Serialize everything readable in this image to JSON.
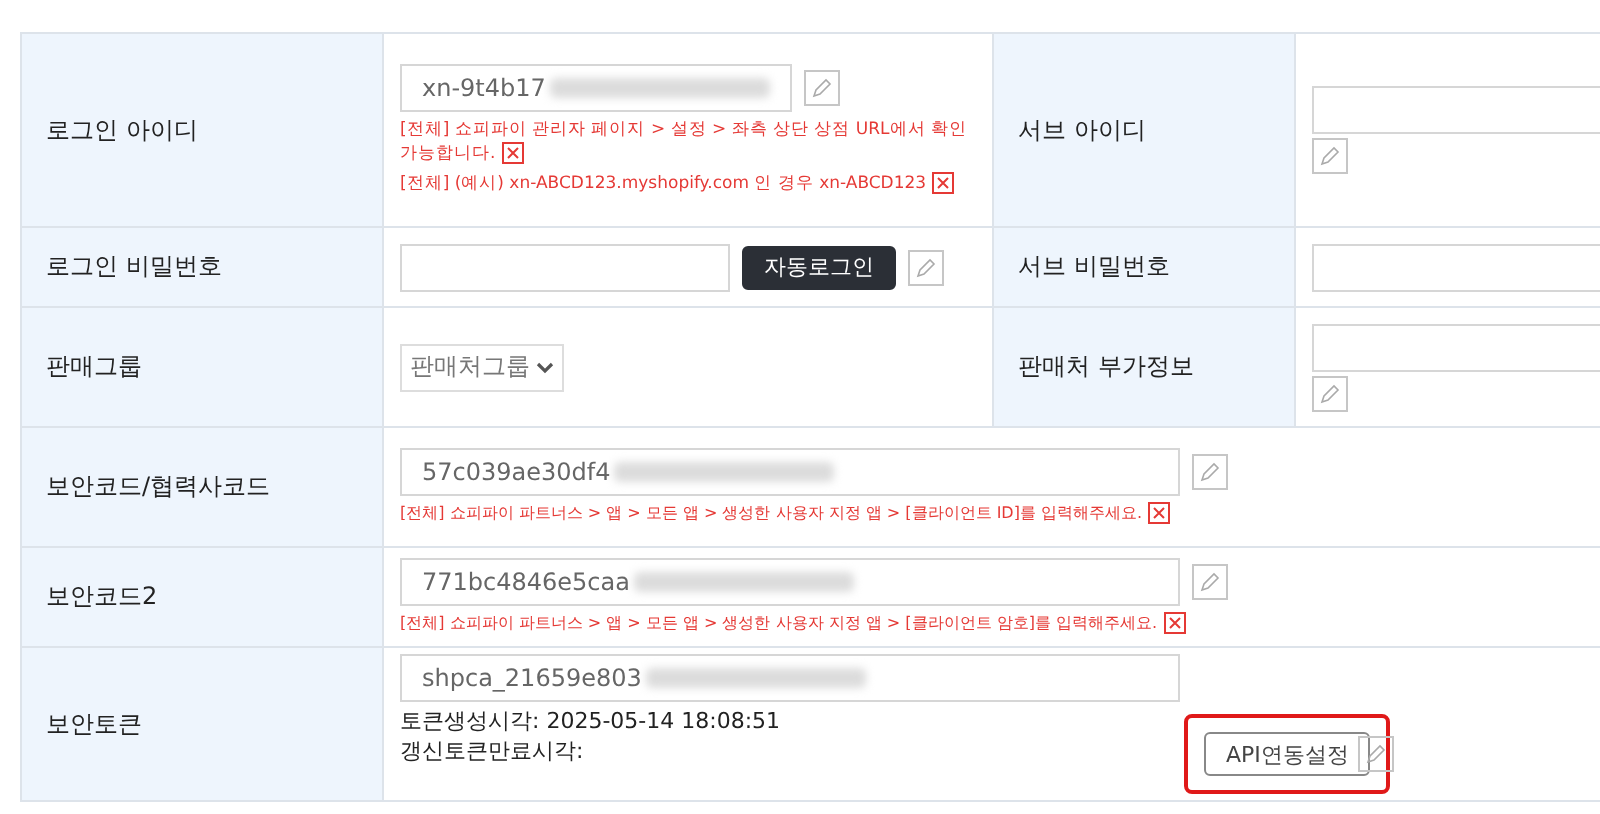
{
  "rows": [
    {
      "label": "로그인 아이디",
      "field": {
        "value": "xn-9t4b17",
        "blurred": true
      },
      "edit": true,
      "hints": [
        "[전체] 쇼피파이 관리자 페이지 > 설정 > 좌측 상단 상점 URL에서 확인 가능합니다.",
        "[전체] (예시) xn-ABCD123.myshopify.com 인 경우 xn-ABCD123"
      ],
      "side": {
        "label": "서브 아이디",
        "edit_below": true
      }
    },
    {
      "label": "로그인 비밀번호",
      "field": {},
      "button": {
        "label": "자동로그인",
        "kind": "dark"
      },
      "edit": true,
      "side": {
        "label": "서브 비밀번호"
      }
    },
    {
      "label": "판매그룹",
      "select": {
        "value": "판매처그룹"
      },
      "side": {
        "label": "판매처 부가정보",
        "edit_below": true
      }
    },
    {
      "label": "보안코드/협력사코드",
      "field": {
        "value": "57c039ae30df4",
        "blurred": true
      },
      "edit": true,
      "hints": [
        "[전체] 쇼피파이 파트너스 > 앱 > 모든 앱 > 생성한 사용자 지정 앱 > [클라이언트 ID]를 입력해주세요."
      ]
    },
    {
      "label": "보안코드2",
      "field": {
        "value": "771bc4846e5caa",
        "blurred": true
      },
      "edit": true,
      "hints": [
        "[전체] 쇼피파이 파트너스 > 앱 > 모든 앱 > 생성한 사용자 지정 앱 > [클라이언트 암호]를 입력해주세요."
      ]
    },
    {
      "label": "보안토큰",
      "field": {
        "value": "shpca_21659e803",
        "blurred": true
      },
      "info": [
        "토큰생성시각: 2025-05-14 18:08:51",
        "갱신토큰만료시각:"
      ],
      "button": {
        "label": "API연동설정",
        "kind": "outline",
        "highlighted": true
      },
      "edit": true
    }
  ]
}
